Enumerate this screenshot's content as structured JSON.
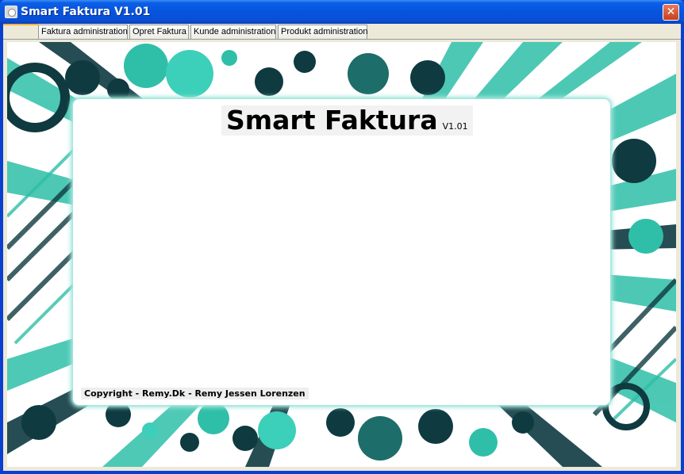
{
  "window": {
    "title": "Smart Faktura V1.01",
    "close_glyph": "✕"
  },
  "tabs": [
    {
      "label": "Faktura administration"
    },
    {
      "label": "Opret Faktura"
    },
    {
      "label": "Kunde administration"
    },
    {
      "label": "Produkt administration"
    }
  ],
  "main": {
    "title": "Smart Faktura",
    "version": "V1.01",
    "copyright": "Copyright - Remy.Dk - Remy Jessen Lorenzen"
  },
  "colors": {
    "titlebar": "#0654dd",
    "accent_teal": "#2ec4b0",
    "dark_teal": "#0e3a40"
  },
  "icons": {
    "app": "app-window-icon",
    "close": "close-icon"
  }
}
